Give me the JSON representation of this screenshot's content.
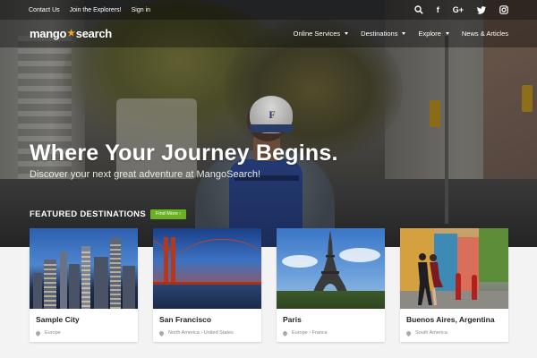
{
  "topbar": {
    "links": [
      "Contact Us",
      "Join the Explorers!",
      "Sign in"
    ],
    "icons": [
      "search-icon",
      "facebook-icon",
      "google-plus-icon",
      "twitter-icon",
      "instagram-icon"
    ],
    "icon_glyphs": {
      "facebook": "f",
      "gplus": "G+"
    }
  },
  "nav": {
    "logo_part1": "mango",
    "logo_part2": "search",
    "items": [
      {
        "label": "Online Services",
        "dropdown": true
      },
      {
        "label": "Destinations",
        "dropdown": true
      },
      {
        "label": "Explore",
        "dropdown": true
      },
      {
        "label": "News & Articles",
        "dropdown": false
      }
    ]
  },
  "hero": {
    "title": "Where Your Journey Begins.",
    "subtitle": "Discover your next great adventure at MangoSearch!",
    "cap_letter": "F"
  },
  "featured": {
    "title": "FEATURED DESTINATIONS",
    "button": "Find More  ›",
    "cards": [
      {
        "name": "Sample City",
        "location": "Europe"
      },
      {
        "name": "San Francisco",
        "location": "North America › United States"
      },
      {
        "name": "Paris",
        "location": "Europe › France"
      },
      {
        "name": "Buenos Aires, Argentina",
        "location": "South America"
      }
    ]
  },
  "colors": {
    "accent_green": "#6ab023",
    "logo_star": "#f5a623",
    "card_bg": "#ffffff",
    "page_bg": "#f3f3f3"
  }
}
